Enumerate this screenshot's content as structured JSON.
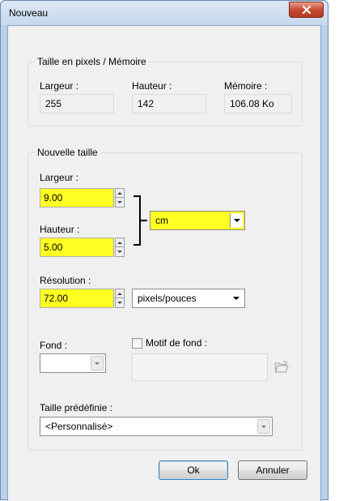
{
  "window": {
    "title": "Nouveau"
  },
  "memory_group": {
    "title": "Taille en pixels / Mémoire",
    "width_label": "Largeur :",
    "height_label": "Hauteur :",
    "memory_label": "Mémoire :",
    "width_value": "255",
    "height_value": "142",
    "memory_value": "106.08 Ko"
  },
  "new_size_group": {
    "title": "Nouvelle taille",
    "width_label": "Largeur :",
    "width_value": "9.00",
    "height_label": "Hauteur :",
    "height_value": "5.00",
    "unit_selected": "cm",
    "resolution_label": "Résolution :",
    "resolution_value": "72.00",
    "resolution_unit_selected": "pixels/pouces",
    "background_label": "Fond :",
    "pattern_label": "Motif de fond :",
    "pattern_checked": false,
    "preset_label": "Taille prédéfinie :",
    "preset_selected": "<Personnalisé>"
  },
  "buttons": {
    "ok": "Ok",
    "cancel": "Annuler"
  },
  "colors": {
    "highlight": "#ffff22",
    "window_frame": "#b9d1ea",
    "close_button": "#c74a30"
  },
  "icons": [
    "close-icon",
    "folder-open-icon",
    "dropdown-arrow-icon",
    "spin-up-icon",
    "spin-down-icon"
  ]
}
